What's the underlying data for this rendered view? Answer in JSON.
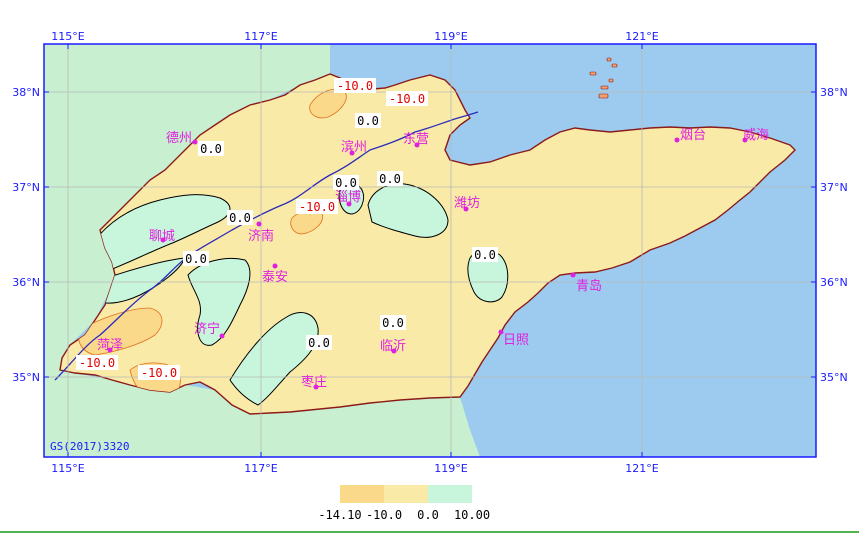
{
  "map": {
    "longitude_ticks": [
      "115°E",
      "117°E",
      "119°E",
      "121°E"
    ],
    "latitude_ticks": [
      "38°N",
      "37°N",
      "36°N",
      "35°N"
    ],
    "credit": "GS(2017)3320",
    "colors": {
      "sea": "#9ccbef",
      "outside_land": "#c8f0d0",
      "base_class": "#faeaa8",
      "low_class": "#fad98a",
      "high_class": "#c8f6dc",
      "coast": "#8b1a1a",
      "river": "#2b2bbb",
      "frame": "#1a1aff",
      "grid": "#b8b8b8",
      "city": "#e020e0",
      "contour_negative": "#e00000",
      "contour_zero": "#000000"
    },
    "cities": [
      {
        "name": "德州"
      },
      {
        "name": "滨州"
      },
      {
        "name": "东营"
      },
      {
        "name": "烟台"
      },
      {
        "name": "威海"
      },
      {
        "name": "淄博"
      },
      {
        "name": "潍坊"
      },
      {
        "name": "聊城"
      },
      {
        "name": "济南"
      },
      {
        "name": "泰安"
      },
      {
        "name": "青岛"
      },
      {
        "name": "济宁"
      },
      {
        "name": "临沂"
      },
      {
        "name": "日照"
      },
      {
        "name": "菏泽"
      },
      {
        "name": "枣庄"
      }
    ],
    "contour_labels": [
      {
        "text": "-10.0"
      },
      {
        "text": "-10.0"
      },
      {
        "text": "0.0"
      },
      {
        "text": "0.0"
      },
      {
        "text": "0.0"
      },
      {
        "text": "0.0"
      },
      {
        "text": "-10.0"
      },
      {
        "text": "0.0"
      },
      {
        "text": "0.0"
      },
      {
        "text": "0.0"
      },
      {
        "text": "0.0"
      },
      {
        "text": "0.0"
      },
      {
        "text": "-10.0"
      },
      {
        "text": "-10.0"
      }
    ]
  },
  "legend": {
    "ticks": [
      "-14.10",
      "-10.0",
      "0.0",
      "10.00"
    ]
  }
}
